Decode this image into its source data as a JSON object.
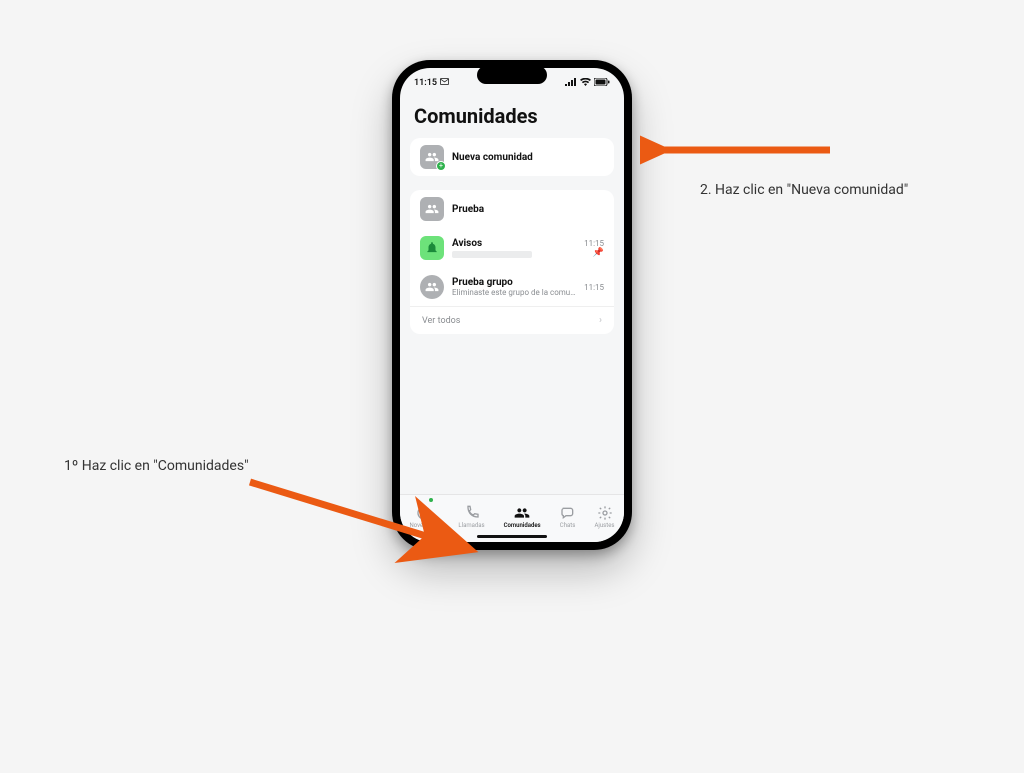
{
  "status": {
    "time": "11:15"
  },
  "header": {
    "title": "Comunidades"
  },
  "newCommunity": {
    "label": "Nueva comunidad"
  },
  "community": {
    "name": "Prueba",
    "items": [
      {
        "title": "Avisos",
        "time": "11:15",
        "pinned": true
      },
      {
        "title": "Prueba grupo",
        "subtitle": "Eliminaste este grupo de la comu…",
        "time": "11:15"
      }
    ],
    "seeAll": "Ver todos"
  },
  "tabs": {
    "novedades": "Novedades",
    "llamadas": "Llamadas",
    "comunidades": "Comunidades",
    "chats": "Chats",
    "ajustes": "Ajustes"
  },
  "annotations": {
    "step1": "1º Haz clic en \"Comunidades\"",
    "step2": "2. Haz clic en \"Nueva comunidad\""
  },
  "colors": {
    "arrow": "#eb5a13"
  }
}
